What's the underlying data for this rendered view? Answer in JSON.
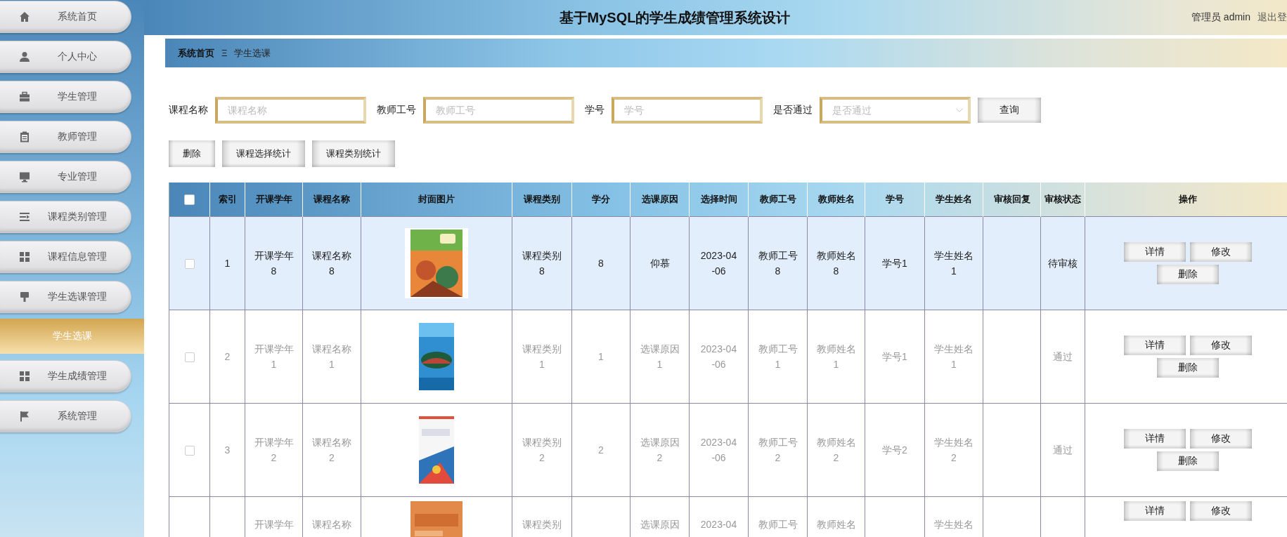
{
  "sidebar": {
    "items": [
      {
        "label": "系统首页",
        "kind": "menu",
        "selected": false
      },
      {
        "label": "个人中心",
        "kind": "menu",
        "selected": false
      },
      {
        "label": "学生管理",
        "kind": "menu",
        "selected": false
      },
      {
        "label": "教师管理",
        "kind": "menu",
        "selected": false
      },
      {
        "label": "专业管理",
        "kind": "menu",
        "selected": false
      },
      {
        "label": "课程类别管理",
        "kind": "menu",
        "selected": false
      },
      {
        "label": "课程信息管理",
        "kind": "menu",
        "selected": false
      },
      {
        "label": "学生选课管理",
        "kind": "menu",
        "selected": false
      },
      {
        "label": "学生选课",
        "kind": "sub",
        "selected": true
      },
      {
        "label": "学生成绩管理",
        "kind": "menu",
        "selected": false
      },
      {
        "label": "系统管理",
        "kind": "menu",
        "selected": false
      }
    ]
  },
  "header": {
    "title": "基于MySQL的学生成绩管理系统设计",
    "user": "管理员 admin",
    "logout": "退出登"
  },
  "breadcrumb": {
    "items": [
      "系统首页",
      "学生选课"
    ],
    "separator": "Ξ"
  },
  "search": {
    "fields": [
      {
        "label": "课程名称",
        "placeholder": "课程名称",
        "kind": "text"
      },
      {
        "label": "教师工号",
        "placeholder": "教师工号",
        "kind": "text"
      },
      {
        "label": "学号",
        "placeholder": "学号",
        "kind": "text"
      },
      {
        "label": "是否通过",
        "placeholder": "是否通过",
        "kind": "select"
      }
    ],
    "button": "查询"
  },
  "actions": [
    "删除",
    "课程选择统计",
    "课程类别统计"
  ],
  "table": {
    "select_all": {
      "checked": false
    },
    "columns": [
      "索引",
      "开课学年",
      "课程名称",
      "封面图片",
      "课程类别",
      "学分",
      "选课原因",
      "选择时间",
      "教师工号",
      "教师姓名",
      "学号",
      "学生姓名",
      "审核回复",
      "审核状态",
      "操作"
    ],
    "rows": [
      {
        "kind": "full",
        "selected": true,
        "checked": false,
        "index": "1",
        "year": "开课学年\n8",
        "course": "课程名称\n8",
        "cover": {
          "kind": "picture"
        },
        "category": "课程类别\n8",
        "credit": "8",
        "reason": "仰慕",
        "time": "2023-04\n-06",
        "teacher_no": "教师工号\n8",
        "teacher_name": "教师姓名\n8",
        "student_no": "学号1",
        "student_name": "学生姓名\n1",
        "status": "待审核",
        "buttons": [
          "详情",
          "修改",
          "删除"
        ]
      },
      {
        "kind": "full",
        "selected": false,
        "checked": false,
        "index": "2",
        "year": "开课学年\n1",
        "course": "课程名称\n1",
        "cover": {
          "kind": "picture"
        },
        "category": "课程类别\n1",
        "credit": "1",
        "reason": "选课原因\n1",
        "time": "2023-04\n-06",
        "teacher_no": "教师工号\n1",
        "teacher_name": "教师姓名\n1",
        "student_no": "学号1",
        "student_name": "学生姓名\n1",
        "status": "通过",
        "buttons": [
          "详情",
          "修改",
          "删除"
        ]
      },
      {
        "kind": "full",
        "selected": false,
        "checked": false,
        "index": "3",
        "year": "开课学年\n2",
        "course": "课程名称\n2",
        "cover": {
          "kind": "picture"
        },
        "category": "课程类别\n2",
        "credit": "2",
        "reason": "选课原因\n2",
        "time": "2023-04\n-06",
        "teacher_no": "教师工号\n2",
        "teacher_name": "教师姓名\n2",
        "student_no": "学号2",
        "student_name": "学生姓名\n2",
        "status": "通过",
        "buttons": [
          "详情",
          "修改",
          "删除"
        ]
      },
      {
        "kind": "partial",
        "selected": false,
        "year": "开课学年",
        "course": "课程名称",
        "cover": {
          "kind": "picture"
        },
        "category": "课程类别",
        "reason": "选课原因",
        "time": "2023-04",
        "teacher_no": "教师工号",
        "teacher_name": "教师姓名",
        "student_name": "学生姓名",
        "buttons": [
          "详情",
          "修改"
        ]
      }
    ]
  }
}
